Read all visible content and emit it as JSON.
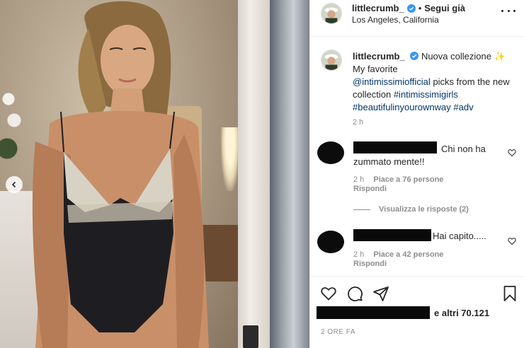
{
  "header": {
    "username": "littlecrumb_",
    "separator": "•",
    "follow_label": "Segui già",
    "location": "Los Angeles, California"
  },
  "caption": {
    "username": "littlecrumb_",
    "text_start": "Nuova collezione",
    "sparkle": "✨",
    "line2": "My favorite",
    "mention": "@intimissimiofficial",
    "text_mid": "picks from the new collection",
    "hashtag1": "#intimissimigirls",
    "hashtag2": "#beautifulinyourownway",
    "hashtag3": "#adv",
    "time": "2 h"
  },
  "comments": [
    {
      "text": "Chi non ha zummato mente!!",
      "time": "2 h",
      "likes": "Piace a 76 persone",
      "reply": "Rispondi"
    },
    {
      "text": "Hai capito.....",
      "time": "2 h",
      "likes": "Piace a 42 persone",
      "reply": "Rispondi"
    }
  ],
  "view_replies": "Visualizza le risposte (2)",
  "likes_summary": "e altri 70.121",
  "post_time": "2 ORE FA",
  "colors": {
    "link": "#003569",
    "muted": "#8e8e8e",
    "text": "#262626",
    "verified": "#3897f0"
  },
  "icons": {
    "more": "more-options-icon",
    "verified": "verified-badge-icon",
    "like": "heart-icon",
    "comment": "comment-icon",
    "share": "share-icon",
    "save": "bookmark-icon",
    "carousel_prev": "chevron-left-icon"
  }
}
